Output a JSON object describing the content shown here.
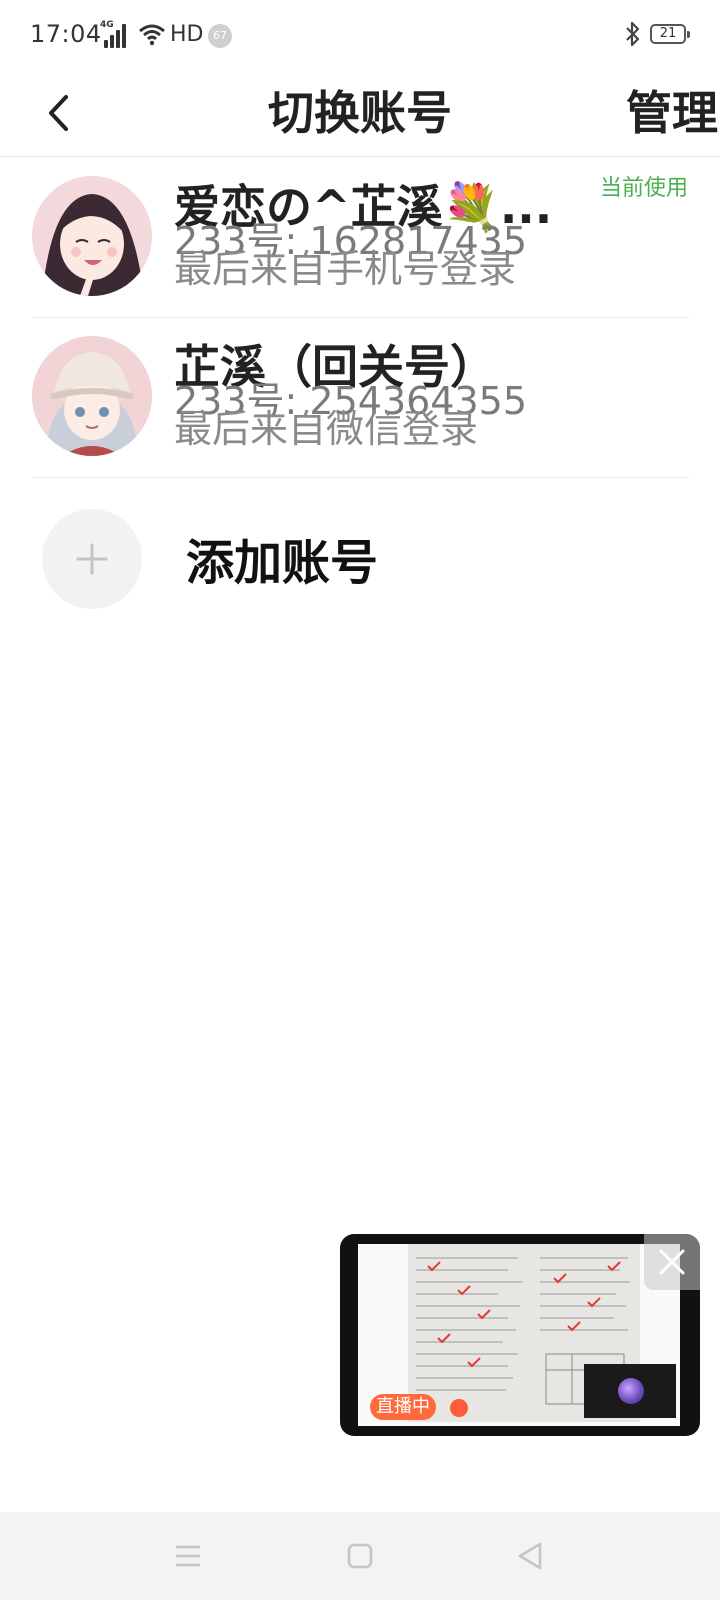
{
  "status_bar": {
    "time": "17:04",
    "network": "4G",
    "hd": "HD",
    "notification_count": "67",
    "battery": "21"
  },
  "header": {
    "title": "切换账号",
    "manage_label": "管理"
  },
  "accounts": [
    {
      "name": "爱恋の^芷溪💐...",
      "id": "233号: 162817435",
      "login": "最后来自手机号登录",
      "badge": "当前使用"
    },
    {
      "name": "芷溪（回关号）",
      "id": "233号: 254364355",
      "login": "最后来自微信登录"
    }
  ],
  "add_account": {
    "label": "添加账号"
  },
  "live_window": {
    "badge": "直播中"
  },
  "colors": {
    "accent_green": "#4caf50",
    "live_orange": "#ff6a3d"
  }
}
